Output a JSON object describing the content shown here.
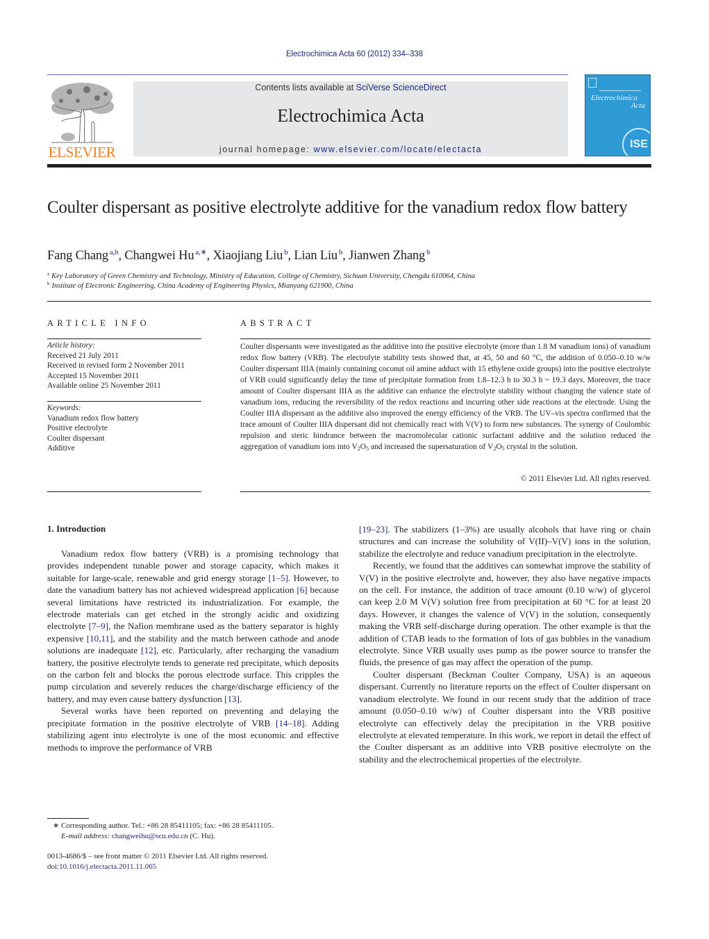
{
  "header": {
    "citation": "Electrochimica Acta 60 (2012) 334–338",
    "contents_prefix": "Contents lists available at ",
    "contents_link": "SciVerse ScienceDirect",
    "journal_name": "Electrochimica Acta",
    "homepage_prefix": "journal homepage: ",
    "homepage_link": "www.elsevier.com/locate/electacta",
    "publisher_logo_text": "ELSEVIER",
    "cover": {
      "title_line1": "Electrochimica",
      "title_line2": "Acta",
      "badge": "ISE"
    }
  },
  "article": {
    "title": "Coulter dispersant as positive electrolyte additive for the vanadium redox flow battery",
    "authors": [
      {
        "name": "Fang Chang",
        "sup": "a,b",
        "sep": ", "
      },
      {
        "name": "Changwei Hu",
        "sup": "a,∗",
        "sep": ", "
      },
      {
        "name": "Xiaojiang Liu",
        "sup": "b",
        "sep": ", "
      },
      {
        "name": "Lian Liu",
        "sup": "b",
        "sep": ", "
      },
      {
        "name": "Jianwen Zhang",
        "sup": "b",
        "sep": ""
      }
    ],
    "affiliations": [
      {
        "key": "a",
        "text": "Key Laboratory of Green Chemistry and Technology, Ministry of Education, College of Chemistry, Sichuan University, Chengdu 610064, China"
      },
      {
        "key": "b",
        "text": "Institute of Electronic Engineering, China Academy of Engineering Physics, Mianyang 621900, China"
      }
    ]
  },
  "article_info": {
    "heading": "ARTICLE INFO",
    "history_label": "Article history:",
    "history": [
      "Received 21 July 2011",
      "Received in revised form 2 November 2011",
      "Accepted 15 November 2011",
      "Available online 25 November 2011"
    ],
    "keywords_label": "Keywords:",
    "keywords": [
      "Vanadium redox flow battery",
      "Positive electrolyte",
      "Coulter dispersant",
      "Additive"
    ]
  },
  "abstract": {
    "heading": "ABSTRACT",
    "text_part1": "Coulter dispersants were investigated as the additive into the positive electrolyte (more than 1.8 M vanadium ions) of vanadium redox flow battery (VRB). The electrolyte stability tests showed that, at 45, 50 and 60 °C, the addition of 0.050–0.10 w/w Coulter dispersant IIIA (mainly containing coconut oil amine adduct with 15 ethylene oxide groups) into the positive electrolyte of VRB could significantly delay the time of precipitate formation from 1.8–12.3 h to 30.3 h ~ 19.3 days. Moreover, the trace amount of Coulter dispersant IIIA as the additive can enhance the electrolyte stability without changing the valence state of vanadium ions, reducing the reversibility of the redox reactions and incurring other side reactions at the electrode. Using the Coulter IIIA dispersant as the additive also improved the energy efficiency of the VRB. The UV–vis spectra confirmed that the trace amount of Coulter IIIA dispersant did not chemically react with V(V) to form new substances. The synergy of Coulombic repulsion and steric hindrance between the macromolecular cationic surfactant additive and the solution reduced the aggregation of vanadium ions into V",
    "sub1": "2",
    "mid1": "O",
    "sub2": "5",
    "text_part2": " and increased the supersaturation of V",
    "sub3": "2",
    "mid2": "O",
    "sub4": "5",
    "text_part3": " crystal in the solution.",
    "copyright": "© 2011 Elsevier Ltd. All rights reserved."
  },
  "body": {
    "section_heading": "1.  Introduction",
    "left_paragraphs": [
      {
        "indent": true,
        "segments": [
          {
            "t": "Vanadium redox flow battery (VRB) is a promising technology that provides independent tunable power and storage capacity, which makes it suitable for large-scale, renewable and grid energy storage "
          },
          {
            "t": "[1–5]",
            "ref": true
          },
          {
            "t": ". However, to date the vanadium battery has not achieved widespread application "
          },
          {
            "t": "[6]",
            "ref": true
          },
          {
            "t": " because several limitations have restricted its industrialization. For example, the electrode materials can get etched in the strongly acidic and oxidizing electrolyte "
          },
          {
            "t": "[7–9]",
            "ref": true
          },
          {
            "t": ", the Nafion membrane used as the battery separator is highly expensive "
          },
          {
            "t": "[10,11]",
            "ref": true
          },
          {
            "t": ", and the stability and the match between cathode and anode solutions are inadequate "
          },
          {
            "t": "[12]",
            "ref": true
          },
          {
            "t": ", etc. Particularly, after recharging the vanadium battery, the positive electrolyte tends to generate red precipitate, which deposits on the carbon felt and blocks the porous electrode surface. This cripples the pump circulation and severely reduces the charge/discharge efficiency of the battery, and may even cause battery dysfunction "
          },
          {
            "t": "[13]",
            "ref": true
          },
          {
            "t": "."
          }
        ]
      },
      {
        "indent": true,
        "segments": [
          {
            "t": "Several works have been reported on preventing and delaying the precipitate formation in the positive electrolyte of VRB "
          },
          {
            "t": "[14–18]",
            "ref": true
          },
          {
            "t": ". Adding stabilizing agent into electrolyte is one of the most economic and effective methods to improve the performance of VRB"
          }
        ]
      }
    ],
    "right_paragraphs": [
      {
        "indent": false,
        "segments": [
          {
            "t": "[19–23]",
            "ref": true
          },
          {
            "t": ". The stabilizers (1–3%) are usually alcohols that have ring or chain structures and can increase the solubility of V(II)–V(V) ions in the solution, stabilize the electrolyte and reduce vanadium precipitation in the electrolyte."
          }
        ]
      },
      {
        "indent": true,
        "segments": [
          {
            "t": "Recently, we found that the additives can somewhat improve the stability of V(V) in the positive electrolyte and, however, they also have negative impacts on the cell. For instance, the addition of trace amount (0.10 w/w) of glycerol can keep 2.0 M V(V) solution free from precipitation at 60 °C for at least 20 days. However, it changes the valence of V(V) in the solution, consequently making the VRB self-discharge during operation. The other example is that the addition of CTAB leads to the formation of lots of gas bubbles in the vanadium electrolyte. Since VRB usually uses pump as the power source to transfer the fluids, the presence of gas may affect the operation of the pump."
          }
        ]
      },
      {
        "indent": true,
        "segments": [
          {
            "t": "Coulter dispersant (Beckman Coulter Company, USA) is an aqueous dispersant. Currently no literature reports on the effect of Coulter dispersant on vanadium electrolyte. We found in our recent study that the addition of trace amount (0.050–0.10 w/w) of Coulter dispersant into the VRB positive electrolyte can effectively delay the precipitation in the VRB positive electrolyte at elevated temperature. In this work, we report in detail the effect of the Coulter dispersant as an additive into VRB positive electrolyte on the stability and the electrochemical properties of the electrolyte."
          }
        ]
      }
    ]
  },
  "footnote": {
    "marker": "∗",
    "corresponding": " Corresponding author. Tel.: +86 28 85411105; fax: +86 28 85411105.",
    "email_label": "E-mail address:",
    "email": "changweihu@scu.edu.cn",
    "email_suffix": " (C. Hu)."
  },
  "front_matter": {
    "issn_line": "0013-4686/$ – see front matter © 2011 Elsevier Ltd. All rights reserved.",
    "doi_prefix": "doi:",
    "doi": "10.1016/j.electacta.2011.11.065"
  },
  "colors": {
    "link": "#1f2a7a",
    "elsevier_orange": "#f07d22",
    "banner_gray": "#e6e7e8",
    "cover_blue": "#2e9bd6"
  }
}
